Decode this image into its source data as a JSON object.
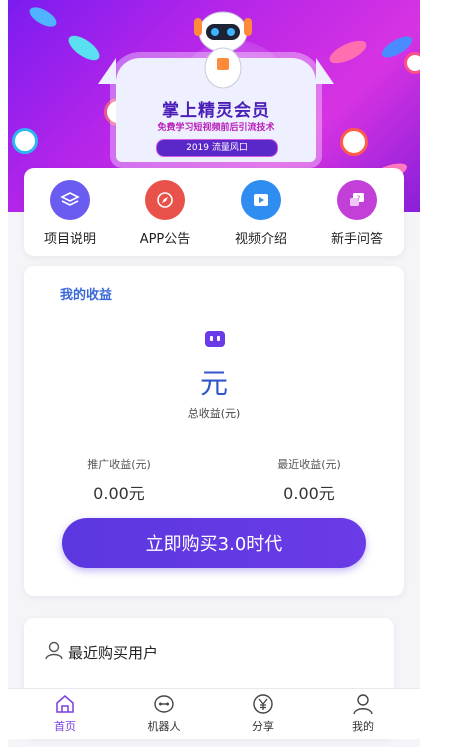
{
  "banner": {
    "title": "掌上精灵会员",
    "subtitle": "免费学习短视频前后引流技术",
    "tag": "2019 流量风口"
  },
  "quick_links": [
    {
      "label": "项目说明",
      "icon": "layers-icon",
      "color": "#6a5cf0"
    },
    {
      "label": "APP公告",
      "icon": "compass-icon",
      "color": "#e8524a"
    },
    {
      "label": "视频介绍",
      "icon": "video-icon",
      "color": "#2f8cf0"
    },
    {
      "label": "新手问答",
      "icon": "question-chat-icon",
      "color": "#c23fd8"
    }
  ],
  "earnings": {
    "title": "我的收益",
    "amount": "元",
    "total_label": "总收益(元)",
    "promo_label": "推广收益(元)",
    "promo_value": "0.00元",
    "recent_label": "最近收益(元)",
    "recent_value": "0.00元",
    "buy_button": "立即购买3.0时代"
  },
  "recent_buyers": {
    "title": "最近购买用户"
  },
  "tabbar": [
    {
      "label": "首页",
      "icon": "home-icon",
      "active": true
    },
    {
      "label": "机器人",
      "icon": "robot-icon",
      "active": false
    },
    {
      "label": "分享",
      "icon": "yen-icon",
      "active": false
    },
    {
      "label": "我的",
      "icon": "user-icon",
      "active": false
    }
  ],
  "colors": {
    "accent": "#5b37e0",
    "link_blue": "#3b6ad8",
    "active_tab": "#7a3fe0"
  }
}
